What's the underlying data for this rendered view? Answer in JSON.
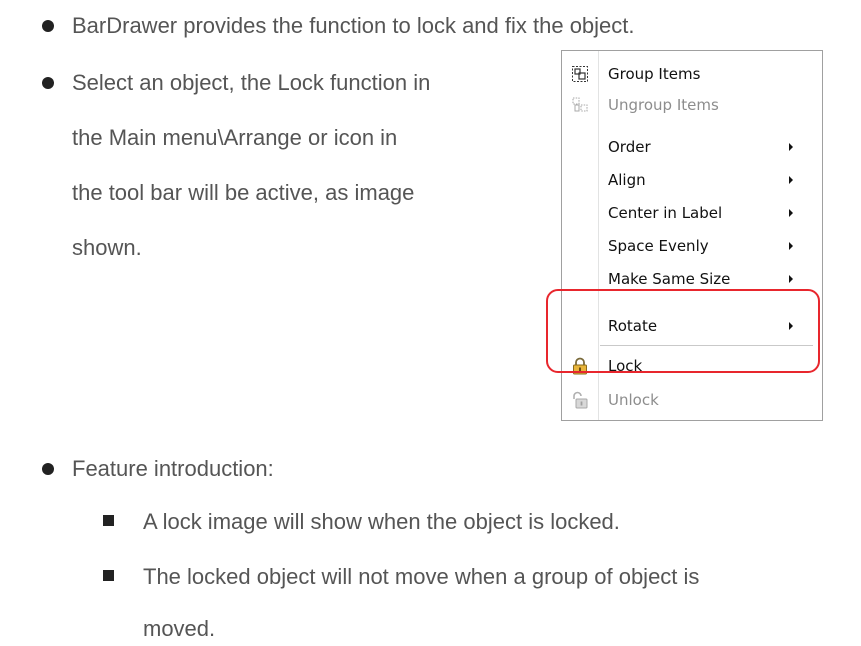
{
  "bullets": {
    "b1": "BarDrawer provides the function to lock and fix the object.",
    "b2_lines": [
      "Select an object, the Lock function in",
      "the Main menu\\Arrange or icon in",
      "the tool bar will be active, as image",
      "shown."
    ],
    "b3": "Feature introduction:",
    "sub1": "A lock image will show when the object is locked.",
    "sub2_lines": [
      "The locked object will not move when a group of object is",
      "moved."
    ]
  },
  "menu": {
    "items": [
      {
        "label": "Group Items",
        "icon": "group-items-icon",
        "enabled": true,
        "submenu": false
      },
      {
        "label": "Ungroup Items",
        "icon": "ungroup-items-icon",
        "enabled": false,
        "submenu": false
      },
      {
        "label": "Order",
        "enabled": true,
        "submenu": true
      },
      {
        "label": "Align",
        "enabled": true,
        "submenu": true
      },
      {
        "label": "Center in Label",
        "enabled": true,
        "submenu": true
      },
      {
        "label": "Space Evenly",
        "enabled": true,
        "submenu": true
      },
      {
        "label": "Make Same Size",
        "enabled": true,
        "submenu": true
      },
      {
        "label": "Rotate",
        "enabled": true,
        "submenu": true
      },
      {
        "label": "Lock",
        "icon": "lock-icon",
        "enabled": true,
        "submenu": false
      },
      {
        "label": "Unlock",
        "icon": "unlock-icon",
        "enabled": false,
        "submenu": false
      }
    ]
  },
  "colors": {
    "highlight": "#e8262d",
    "text": "#555555",
    "menu_text": "#111111",
    "menu_disabled": "#8d8d8d"
  }
}
